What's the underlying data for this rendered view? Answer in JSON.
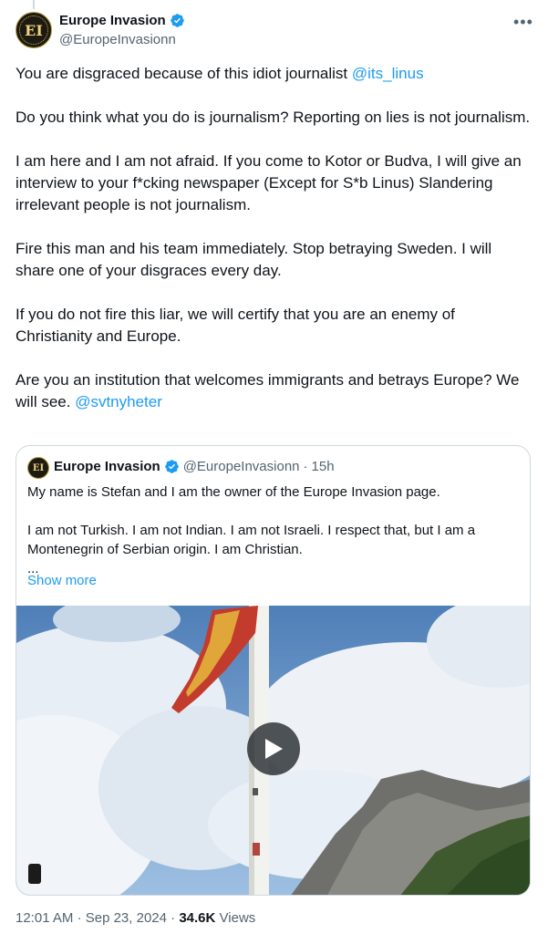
{
  "author": {
    "display_name": "Europe Invasion",
    "handle": "@EuropeInvasionn",
    "avatar_text": "EI"
  },
  "tweet": {
    "p1_text": "You are disgraced because of this idiot journalist ",
    "p1_mention": "@its_linus",
    "p2": "Do you think what you do is journalism? Reporting on lies is not journalism.",
    "p3": "I am here and I am not afraid. If you come to Kotor or Budva, I will give an interview to your f*cking newspaper (Except for S*b Linus) Slandering irrelevant people is not journalism.",
    "p4": "Fire this man and his team immediately. Stop betraying Sweden. I will share one of your disgraces every day.",
    "p5": "If you do not fire this liar, we will certify that you are an enemy of Christianity and Europe.",
    "p6_text": "Are you an institution that welcomes immigrants and betrays Europe? We will see. ",
    "p6_mention": "@svtnyheter"
  },
  "quote": {
    "display_name": "Europe Invasion",
    "handle": "@EuropeInvasionn",
    "separator": "·",
    "time": "15h",
    "p1": "My name is Stefan and I am the owner of the Europe Invasion page.",
    "p2": "I am not Turkish. I am not Indian. I am not Israeli. I respect that, but I am a Montenegrin of Serbian origin. I am Christian.",
    "ellipsis": "...",
    "show_more": "Show more"
  },
  "footer": {
    "time": "12:01 AM",
    "separator": "·",
    "date": "Sep 23, 2024",
    "views_count": "34.6K",
    "views_label": "Views"
  },
  "icons": {
    "verified": "verified-badge-icon",
    "more": "more-options-icon",
    "play": "play-icon"
  },
  "colors": {
    "link": "#1d9bf0",
    "secondary_text": "#536471",
    "primary_text": "#0f1419"
  }
}
